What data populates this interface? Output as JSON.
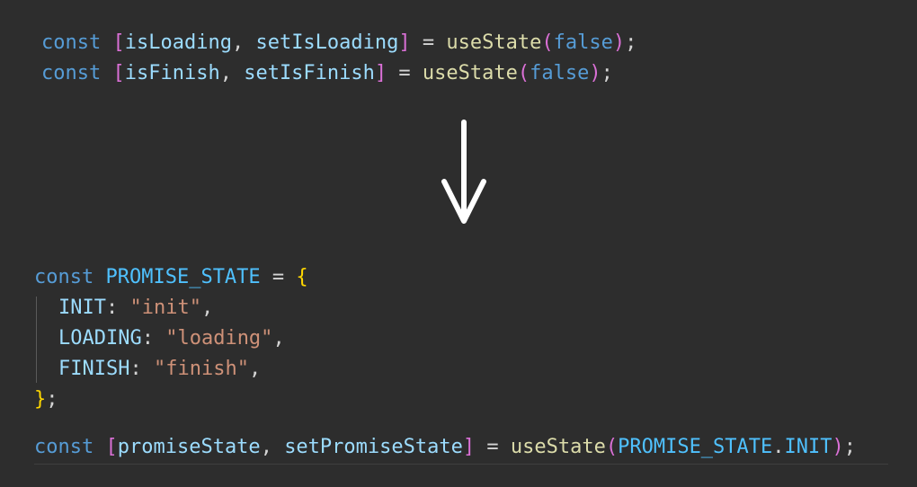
{
  "before": {
    "line1": {
      "kw": "const",
      "open": "[",
      "a": "isLoading",
      "comma": ", ",
      "b": "setIsLoading",
      "close": "]",
      "eq": " = ",
      "fn": "useState",
      "popen": "(",
      "arg": "false",
      "pclose": ")",
      "semi": ";"
    },
    "line2": {
      "kw": "const",
      "open": "[",
      "a": "isFinish",
      "comma": ", ",
      "b": "setIsFinish",
      "close": "]",
      "eq": " = ",
      "fn": "useState",
      "popen": "(",
      "arg": "false",
      "pclose": ")",
      "semi": ";"
    }
  },
  "arrow": {
    "icon": "arrow-down-icon"
  },
  "after": {
    "decl": {
      "kw": "const",
      "name": "PROMISE_STATE",
      "eq": " = ",
      "open": "{"
    },
    "entries": [
      {
        "key": "INIT",
        "colon": ": ",
        "value": "\"init\"",
        "comma": ","
      },
      {
        "key": "LOADING",
        "colon": ": ",
        "value": "\"loading\"",
        "comma": ","
      },
      {
        "key": "FINISH",
        "colon": ": ",
        "value": "\"finish\"",
        "comma": ","
      }
    ],
    "close": {
      "brace": "}",
      "semi": ";"
    },
    "state_line": {
      "kw": "const",
      "open": "[",
      "a": "promiseState",
      "comma": ", ",
      "b": "setPromiseState",
      "close": "]",
      "eq": " = ",
      "fn": "useState",
      "popen": "(",
      "obj": "PROMISE_STATE",
      "dot": ".",
      "prop": "INIT",
      "pclose": ")",
      "semi": ";"
    }
  }
}
